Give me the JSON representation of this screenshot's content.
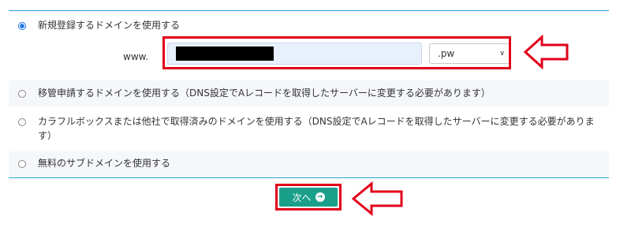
{
  "domain_options": [
    {
      "label": "新規登録するドメインを使用する",
      "selected": true
    },
    {
      "label": "移管申請するドメインを使用する（DNS設定でAレコードを取得したサーバーに変更する必要があります）",
      "selected": false
    },
    {
      "label": "カラフルボックスまたは他社で取得済みのドメインを使用する（DNS設定でAレコードを取得したサーバーに変更する必要があります）",
      "selected": false
    },
    {
      "label": "無料のサブドメインを使用する",
      "selected": false
    }
  ],
  "new_domain": {
    "prefix": "www.",
    "input_value": "",
    "tld_selected": ".pw"
  },
  "next_button": {
    "label": "次へ",
    "icon": "arrow-right-circle-icon"
  },
  "colors": {
    "accent_line": "#2a9fd8",
    "button_bg": "#1aa08a",
    "annotation_red": "#e0001a",
    "radio_selected": "#1a73e8"
  }
}
